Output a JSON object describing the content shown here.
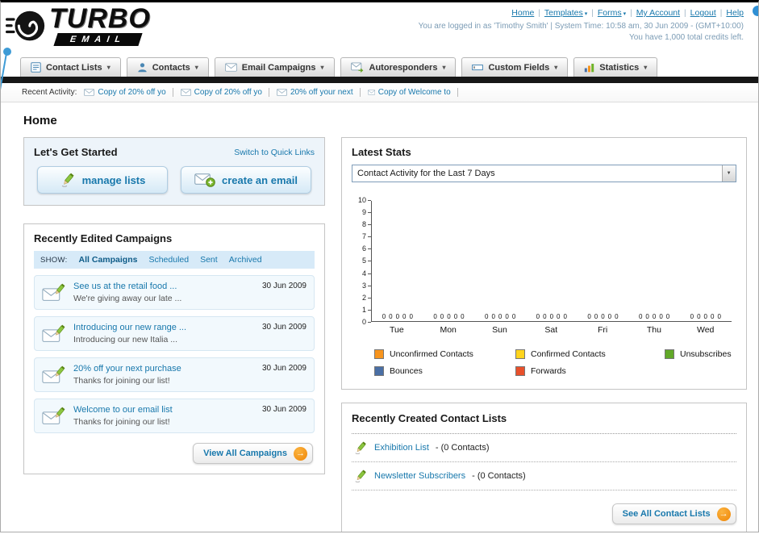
{
  "theme": {
    "link_color": "#1878ac",
    "accent_orange": "#f7941d",
    "nav_bar_color": "#161616",
    "panel_border": "#c4c4c4"
  },
  "header": {
    "logo_primary": "TURBO",
    "logo_secondary": "EMAIL",
    "nav": [
      {
        "label": "Home",
        "dropdown": false
      },
      {
        "label": "Templates",
        "dropdown": true
      },
      {
        "label": "Forms",
        "dropdown": true
      },
      {
        "label": "My Account",
        "dropdown": false
      },
      {
        "label": "Logout",
        "dropdown": false
      },
      {
        "label": "Help",
        "dropdown": false
      }
    ],
    "login_info": "You are logged in as 'Timothy Smith' | System Time: 10:58 am, 30 Jun 2009 - (GMT+10:00)",
    "credits": "You have 1,000 total credits left."
  },
  "tabs": [
    {
      "label": "Contact Lists"
    },
    {
      "label": "Contacts"
    },
    {
      "label": "Email Campaigns"
    },
    {
      "label": "Autoresponders"
    },
    {
      "label": "Custom Fields"
    },
    {
      "label": "Statistics"
    }
  ],
  "recent_activity": {
    "label": "Recent Activity:",
    "items": [
      {
        "text": "Copy of 20% off yo"
      },
      {
        "text": "Copy of 20% off yo"
      },
      {
        "text": "20% off your next"
      },
      {
        "text": "Copy of Welcome to"
      }
    ]
  },
  "page_title": "Home",
  "get_started": {
    "title": "Let's Get Started",
    "switch_link": "Switch to Quick Links",
    "manage_lists_label": "manage lists",
    "create_email_label": "create an email"
  },
  "campaigns": {
    "title": "Recently Edited Campaigns",
    "show_label": "SHOW:",
    "filters": [
      {
        "label": "All Campaigns",
        "active": true
      },
      {
        "label": "Scheduled",
        "active": false
      },
      {
        "label": "Sent",
        "active": false
      },
      {
        "label": "Archived",
        "active": false
      }
    ],
    "items": [
      {
        "title": "See us at the retail food ...",
        "subtitle": "We're giving away our late ...",
        "date": "30 Jun 2009"
      },
      {
        "title": "Introducing our new range ...",
        "subtitle": "Introducing our new Italia ...",
        "date": "30 Jun 2009"
      },
      {
        "title": "20% off your next purchase",
        "subtitle": "Thanks for joining our list!",
        "date": "30 Jun 2009"
      },
      {
        "title": "Welcome to our email list",
        "subtitle": "Thanks for joining our list!",
        "date": "30 Jun 2009"
      }
    ],
    "view_all_label": "View All Campaigns"
  },
  "stats": {
    "title": "Latest Stats",
    "period_selected": "Contact Activity for the Last 7 Days",
    "chart_data": {
      "type": "bar",
      "title": "Contact Activity for the Last 7 Days",
      "categories": [
        "Tue",
        "Mon",
        "Sun",
        "Sat",
        "Fri",
        "Thu",
        "Wed"
      ],
      "series": [
        {
          "name": "Unconfirmed Contacts",
          "color": "#f7941d",
          "values": [
            0,
            0,
            0,
            0,
            0,
            0,
            0
          ]
        },
        {
          "name": "Confirmed Contacts",
          "color": "#ffd41d",
          "values": [
            0,
            0,
            0,
            0,
            0,
            0,
            0
          ]
        },
        {
          "name": "Unsubscribes",
          "color": "#61a828",
          "values": [
            0,
            0,
            0,
            0,
            0,
            0,
            0
          ]
        },
        {
          "name": "Bounces",
          "color": "#4a6fa5",
          "values": [
            0,
            0,
            0,
            0,
            0,
            0,
            0
          ]
        },
        {
          "name": "Forwards",
          "color": "#e8502b",
          "values": [
            0,
            0,
            0,
            0,
            0,
            0,
            0
          ]
        }
      ],
      "ylim": [
        0,
        10
      ],
      "ytick_step": 1,
      "grid": false,
      "legend_position": "bottom"
    }
  },
  "contact_lists": {
    "title": "Recently Created Contact Lists",
    "items": [
      {
        "name": "Exhibition List",
        "detail": "- (0 Contacts)"
      },
      {
        "name": "Newsletter Subscribers",
        "detail": "- (0 Contacts)"
      }
    ],
    "see_all_label": "See All Contact Lists"
  }
}
